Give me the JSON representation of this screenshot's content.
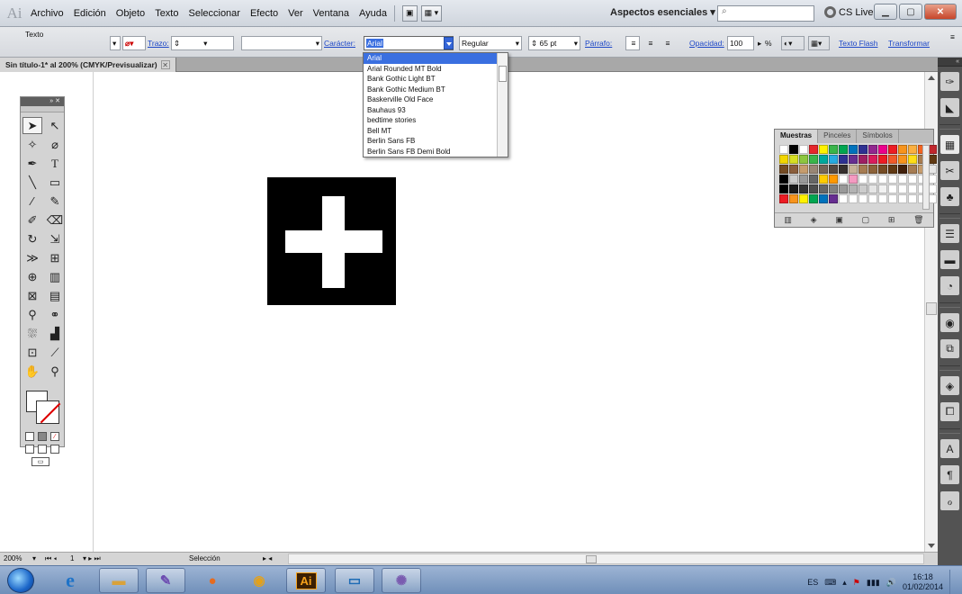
{
  "menubar": {
    "app_logo": "Ai",
    "menus": [
      "Archivo",
      "Edición",
      "Objeto",
      "Texto",
      "Seleccionar",
      "Efecto",
      "Ver",
      "Ventana",
      "Ayuda"
    ],
    "workspace": "Aspectos esenciales ▾",
    "cs_live": "CS Live ▾"
  },
  "controlbar": {
    "object_type": "Texto",
    "stroke_link": "Trazo:",
    "character_link": "Carácter:",
    "font_family": "Arial",
    "font_style": "Regular",
    "font_size": "65 pt",
    "paragraph_link": "Párrafo:",
    "opacity_link": "Opacidad:",
    "opacity_value": "100",
    "opacity_unit": "%",
    "flash_text_link": "Texto Flash",
    "transform_link": "Transformar"
  },
  "document": {
    "tab_title": "Sin título-1* al 200% (CMYK/Previsualizar)",
    "tab_close": "✕"
  },
  "font_list": {
    "options": [
      "Arial",
      "Arial Rounded MT Bold",
      "Bank Gothic Light BT",
      "Bank Gothic Medium BT",
      "Baskerville Old Face",
      "Bauhaus 93",
      "bedtime stories",
      "Bell MT",
      "Berlin Sans FB",
      "Berlin Sans FB Demi Bold"
    ],
    "selected_index": 0
  },
  "swatches": {
    "tabs": [
      "Muestras",
      "Pinceles",
      "Símbolos"
    ],
    "active_tab": "Muestras",
    "colors": [
      "#ffffff",
      "#000000",
      "#ffffff",
      "#e6262b",
      "#fff200",
      "#39b54a",
      "#00a651",
      "#0072bc",
      "#2e3192",
      "#92278f",
      "#ec008c",
      "#ed1c24",
      "#f7941d",
      "#fbb040",
      "#f26522",
      "#c1272d",
      "#f2d600",
      "#d7df23",
      "#8dc63f",
      "#39b54a",
      "#00a99d",
      "#27aae1",
      "#2e3192",
      "#662d91",
      "#9e1f63",
      "#da1c5c",
      "#ed1c24",
      "#f15a29",
      "#f7941d",
      "#ffde17",
      "#a97c50",
      "#603913",
      "#754c24",
      "#8b5e3c",
      "#c69c6d",
      "#998675",
      "#736357",
      "#534741",
      "#362f2d",
      "#c7b299",
      "#a67c52",
      "#8c6239",
      "#754c24",
      "#603913",
      "#42210b",
      "#a67c52",
      "#c69c6d",
      "#e6e6e6",
      "#000000",
      "#cccccc",
      "#999999",
      "#666666",
      "#ffcc00",
      "#ff9900",
      "#ffffff",
      "#f49ac1",
      "#ffffff",
      "#ffffff",
      "#ffffff",
      "#ffffff",
      "#ffffff",
      "#ffffff",
      "#ffffff",
      "#ffffff",
      "#000000",
      "#1a1a1a",
      "#333333",
      "#4d4d4d",
      "#666666",
      "#808080",
      "#999999",
      "#b3b3b3",
      "#cccccc",
      "#e6e6e6",
      "#f2f2f2",
      "#ffffff",
      "#ffffff",
      "#ffffff",
      "#ffffff",
      "#ffffff",
      "#ed1c24",
      "#f7941d",
      "#fff200",
      "#00a651",
      "#0072bc",
      "#662d91",
      "#ffffff",
      "#ffffff",
      "#ffffff",
      "#ffffff",
      "#ffffff",
      "#ffffff",
      "#ffffff",
      "#ffffff",
      "#ffffff",
      "#ffffff"
    ]
  },
  "statusbar": {
    "zoom": "200%",
    "artboard": "1",
    "tool": "Selección"
  },
  "taskbar": {
    "ai_label": "Ai",
    "language": "ES",
    "time": "16:18",
    "date": "01/02/2014"
  }
}
